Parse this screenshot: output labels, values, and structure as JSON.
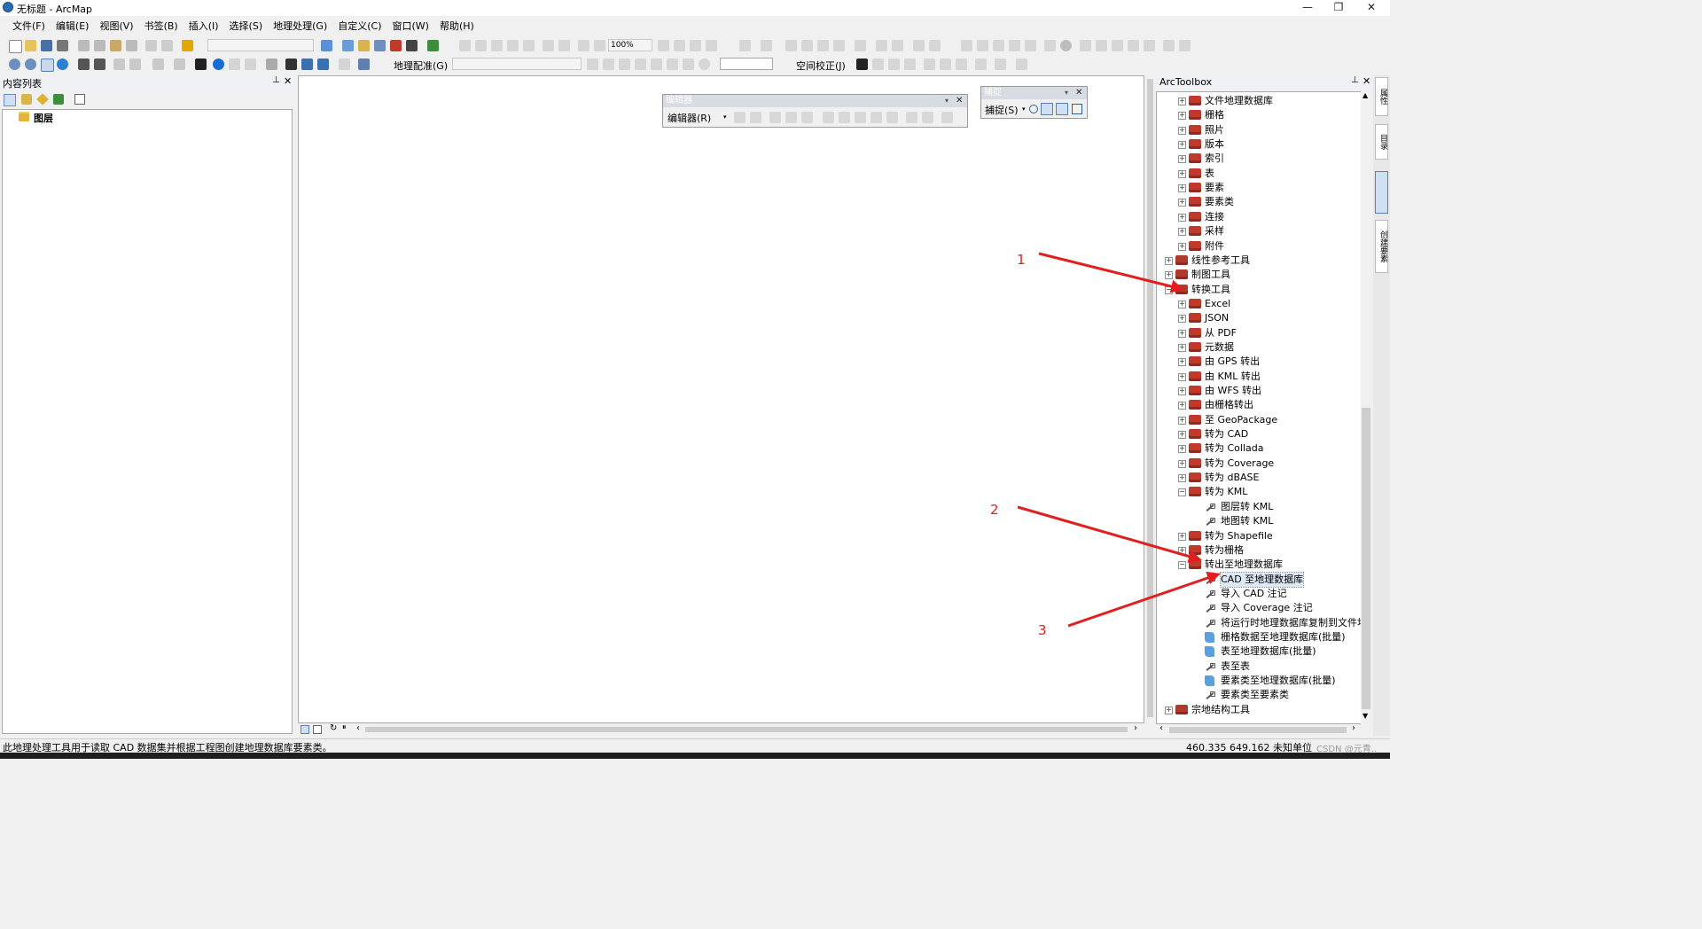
{
  "window": {
    "title": "无标题 - ArcMap",
    "minimize_glyph": "—",
    "restore_glyph": "❐",
    "close_glyph": "✕"
  },
  "menu": [
    "文件(F)",
    "编辑(E)",
    "视图(V)",
    "书签(B)",
    "插入(I)",
    "选择(S)",
    "地理处理(G)",
    "自定义(C)",
    "窗口(W)",
    "帮助(H)"
  ],
  "toolbar1": {
    "zoom_value": "100%"
  },
  "toolbar2": {
    "georef_label": "地理配准(G)",
    "spatial_adjust_label": "空间校正(J)"
  },
  "toc": {
    "title": "内容列表",
    "layers_label": "图层"
  },
  "editor_toolbar": {
    "title": "编辑器",
    "menu_label": "编辑器(R)"
  },
  "snapping_toolbar": {
    "title": "捕捉",
    "menu_label": "捕捉(S)"
  },
  "arctoolbox": {
    "title": "ArcToolbox",
    "items": [
      {
        "label": "文件地理数据库",
        "level": 2,
        "kind": "toolset",
        "state": "+"
      },
      {
        "label": "栅格",
        "level": 2,
        "kind": "toolset",
        "state": "+"
      },
      {
        "label": "照片",
        "level": 2,
        "kind": "toolset",
        "state": "+"
      },
      {
        "label": "版本",
        "level": 2,
        "kind": "toolset",
        "state": "+"
      },
      {
        "label": "索引",
        "level": 2,
        "kind": "toolset",
        "state": "+"
      },
      {
        "label": "表",
        "level": 2,
        "kind": "toolset",
        "state": "+"
      },
      {
        "label": "要素",
        "level": 2,
        "kind": "toolset",
        "state": "+"
      },
      {
        "label": "要素类",
        "level": 2,
        "kind": "toolset",
        "state": "+"
      },
      {
        "label": "连接",
        "level": 2,
        "kind": "toolset",
        "state": "+"
      },
      {
        "label": "采样",
        "level": 2,
        "kind": "toolset",
        "state": "+"
      },
      {
        "label": "附件",
        "level": 2,
        "kind": "toolset",
        "state": "+"
      },
      {
        "label": "线性参考工具",
        "level": 1,
        "kind": "toolbox",
        "state": "+"
      },
      {
        "label": "制图工具",
        "level": 1,
        "kind": "toolbox",
        "state": "+"
      },
      {
        "label": "转换工具",
        "level": 1,
        "kind": "toolbox",
        "state": "-"
      },
      {
        "label": "Excel",
        "level": 2,
        "kind": "toolset",
        "state": "+"
      },
      {
        "label": "JSON",
        "level": 2,
        "kind": "toolset",
        "state": "+"
      },
      {
        "label": "从 PDF",
        "level": 2,
        "kind": "toolset",
        "state": "+"
      },
      {
        "label": "元数据",
        "level": 2,
        "kind": "toolset",
        "state": "+"
      },
      {
        "label": "由 GPS 转出",
        "level": 2,
        "kind": "toolset",
        "state": "+"
      },
      {
        "label": "由 KML 转出",
        "level": 2,
        "kind": "toolset",
        "state": "+"
      },
      {
        "label": "由 WFS 转出",
        "level": 2,
        "kind": "toolset",
        "state": "+"
      },
      {
        "label": "由栅格转出",
        "level": 2,
        "kind": "toolset",
        "state": "+"
      },
      {
        "label": "至 GeoPackage",
        "level": 2,
        "kind": "toolset",
        "state": "+"
      },
      {
        "label": "转为 CAD",
        "level": 2,
        "kind": "toolset",
        "state": "+"
      },
      {
        "label": "转为 Collada",
        "level": 2,
        "kind": "toolset",
        "state": "+"
      },
      {
        "label": "转为 Coverage",
        "level": 2,
        "kind": "toolset",
        "state": "+"
      },
      {
        "label": "转为 dBASE",
        "level": 2,
        "kind": "toolset",
        "state": "+"
      },
      {
        "label": "转为 KML",
        "level": 2,
        "kind": "toolset",
        "state": "-"
      },
      {
        "label": "图层转 KML",
        "level": 3,
        "kind": "tool",
        "state": ""
      },
      {
        "label": "地图转 KML",
        "level": 3,
        "kind": "tool",
        "state": ""
      },
      {
        "label": "转为 Shapefile",
        "level": 2,
        "kind": "toolset",
        "state": "+"
      },
      {
        "label": "转为栅格",
        "level": 2,
        "kind": "toolset",
        "state": "+"
      },
      {
        "label": "转出至地理数据库",
        "level": 2,
        "kind": "toolset",
        "state": "-"
      },
      {
        "label": "CAD 至地理数据库",
        "level": 3,
        "kind": "tool",
        "state": "",
        "selected": true
      },
      {
        "label": "导入 CAD 注记",
        "level": 3,
        "kind": "tool",
        "state": ""
      },
      {
        "label": "导入 Coverage 注记",
        "level": 3,
        "kind": "tool",
        "state": ""
      },
      {
        "label": "将运行时地理数据库复制到文件地理数",
        "level": 3,
        "kind": "tool",
        "state": ""
      },
      {
        "label": "栅格数据至地理数据库(批量)",
        "level": 3,
        "kind": "script",
        "state": ""
      },
      {
        "label": "表至地理数据库(批量)",
        "level": 3,
        "kind": "script",
        "state": ""
      },
      {
        "label": "表至表",
        "level": 3,
        "kind": "tool",
        "state": ""
      },
      {
        "label": "要素类至地理数据库(批量)",
        "level": 3,
        "kind": "script",
        "state": ""
      },
      {
        "label": "要素类至要素类",
        "level": 3,
        "kind": "tool",
        "state": ""
      },
      {
        "label": "宗地结构工具",
        "level": 1,
        "kind": "toolbox",
        "state": "+"
      }
    ]
  },
  "side_tabs": [
    "属性",
    "目录",
    "创建要素"
  ],
  "status": {
    "message": "此地理处理工具用于读取 CAD 数据集并根据工程图创建地理数据库要素类。",
    "coords": "460.335  649.162 未知单位"
  },
  "watermark": "CSDN @元青..",
  "annotations": [
    {
      "label": "1"
    },
    {
      "label": "2"
    },
    {
      "label": "3"
    }
  ],
  "colors": {
    "annotation": "#e02020",
    "toolbox_icon": "#c0392b",
    "selection": "#dde8f6"
  }
}
